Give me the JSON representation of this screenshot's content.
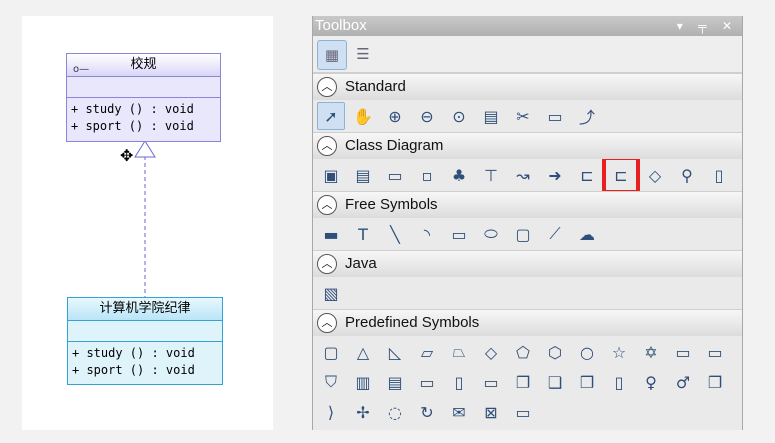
{
  "canvas": {
    "interface": {
      "name": "校规",
      "ops": [
        "+ study () : void",
        "+ sport () : void"
      ]
    },
    "class": {
      "name": "计算机学院纪律",
      "ops": [
        "+ study () : void",
        "+ sport () : void"
      ]
    },
    "cursor_icon": "move-cursor-icon"
  },
  "toolbox": {
    "title": "Toolbox",
    "controls": "▾ ╤ ✕",
    "sections": [
      {
        "label": "Standard",
        "icons": [
          "pointer-icon",
          "hand-icon",
          "zoom-in-icon",
          "zoom-out-icon",
          "zoom-fit-icon",
          "properties-icon",
          "cut-icon",
          "note-icon",
          "connector-icon"
        ]
      },
      {
        "label": "Class Diagram",
        "icons": [
          "package-icon",
          "class-icon",
          "interface-icon",
          "small-class-icon",
          "hierarchy-icon",
          "generalization-icon",
          "association-icon",
          "dependency-icon",
          "realization-icon",
          "realization-selected-icon",
          "aggregation-icon",
          "lollipop-icon",
          "note-page-icon"
        ]
      },
      {
        "label": "Free Symbols",
        "icons": [
          "cylinder-icon",
          "text-icon",
          "line-icon",
          "arc-icon",
          "rectangle-icon",
          "ellipse-icon",
          "rounded-rect-icon",
          "polyline-icon",
          "freeform-icon"
        ]
      },
      {
        "label": "Java",
        "icons": [
          "java-image-icon"
        ]
      },
      {
        "label": "Predefined Symbols",
        "icons": [
          "rounded-rect-icon",
          "triangle-icon",
          "right-triangle-icon",
          "parallelogram-icon",
          "trapezoid-icon",
          "diamond-icon",
          "pentagon-icon",
          "hexagon-icon",
          "octagon-icon",
          "star5-icon",
          "star6-icon",
          "card-icon",
          "tab-rect-icon",
          "shield-icon",
          "frame-icon",
          "frame2-icon",
          "folder-icon",
          "page-icon",
          "callout-icon",
          "stack-icon",
          "cube-icon",
          "cube2-icon",
          "database-icon",
          "actor-icon",
          "actor2-icon",
          "box3d-icon",
          "chevron-icon",
          "cross-shape-icon",
          "cloud-icon",
          "cycle-icon",
          "envelope-icon",
          "frame-box-icon",
          "tag-icon"
        ]
      }
    ]
  },
  "colors": {
    "highlight": "#e82020",
    "interface_fill": "#e9e7fb",
    "class_fill": "#dff3fb"
  }
}
